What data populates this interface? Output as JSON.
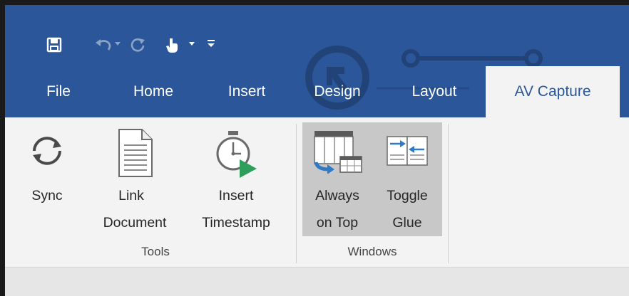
{
  "quick_access": {
    "icons": [
      "save-icon",
      "undo-icon",
      "redo-icon",
      "touch-mode-icon",
      "dropdown-icon",
      "customize-icon"
    ]
  },
  "tabs": [
    {
      "label": "File"
    },
    {
      "label": "Home"
    },
    {
      "label": "Insert"
    },
    {
      "label": "Design"
    },
    {
      "label": "Layout"
    },
    {
      "label": "AV Capture",
      "active": true
    }
  ],
  "ribbon": {
    "groups": [
      {
        "label": "Tools",
        "buttons": [
          {
            "line1": "Sync",
            "line2": "",
            "icon": "sync-icon"
          },
          {
            "line1": "Link",
            "line2": "Document",
            "icon": "document-icon"
          },
          {
            "line1": "Insert",
            "line2": "Timestamp",
            "icon": "timestamp-icon"
          }
        ]
      },
      {
        "label": "Windows",
        "buttons": [
          {
            "line1": "Always",
            "line2": "on Top",
            "icon": "always-on-top-icon",
            "selected": true
          },
          {
            "line1": "Toggle",
            "line2": "Glue",
            "icon": "toggle-glue-icon",
            "selected": true
          }
        ]
      }
    ]
  },
  "colors": {
    "brand": "#2b579a",
    "ribbon_bg": "#f3f3f3",
    "selected_bg": "#c8c8c8",
    "accent_green": "#2e9e5b",
    "accent_blue": "#2f7ac7"
  }
}
